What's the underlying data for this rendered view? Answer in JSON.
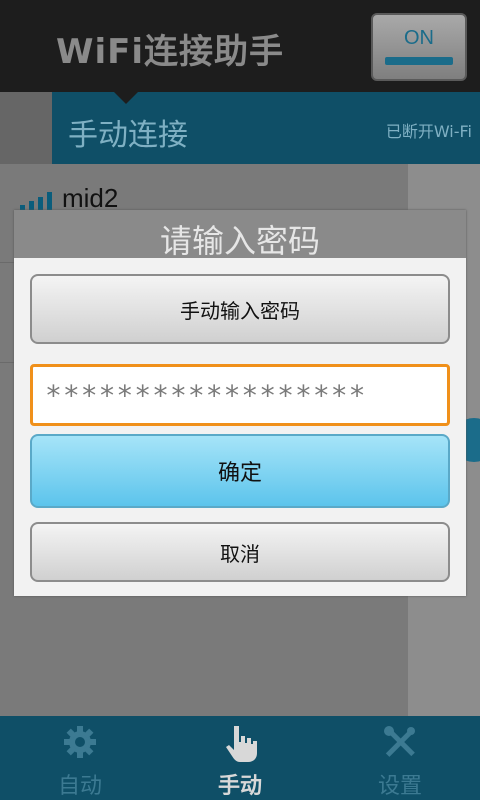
{
  "app": {
    "title": "WiFi连接助手",
    "toggle_label": "ON"
  },
  "section": {
    "title": "手动连接",
    "status": "已断开Wi-Fi"
  },
  "network": {
    "name": "mid2"
  },
  "dialog": {
    "title": "请输入密码",
    "manual_button": "手动输入密码",
    "password_value": "******************",
    "ok_button": "确定",
    "cancel_button": "取消"
  },
  "nav": {
    "items": [
      {
        "label": "自动",
        "icon": "gear-icon"
      },
      {
        "label": "手动",
        "icon": "hand-icon"
      },
      {
        "label": "设置",
        "icon": "tools-icon"
      }
    ]
  },
  "colors": {
    "accent": "#1b6c8a",
    "input_border": "#f0901a",
    "ok_button": "#5cc4ec"
  }
}
